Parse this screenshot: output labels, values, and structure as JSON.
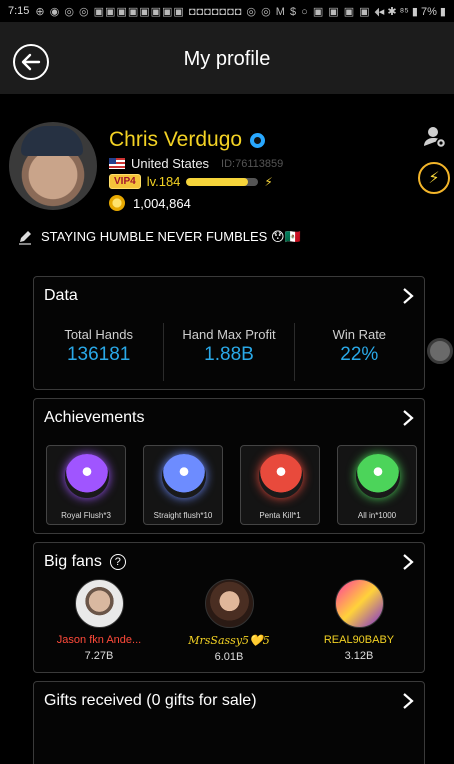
{
  "status_bar": {
    "time": "7:15",
    "notifications": "⊕ ◉ ◎ ◎ ▣▣▣▣▣▣▣▣ ◘◘◘◘◘◘◘ ◎ ◎ M $ ○ ▣ ▣ ▣ ▣ ◆",
    "right": "◂ ✱ ⁸⁵ ▮ 7% ▮"
  },
  "header": {
    "title": "My profile"
  },
  "profile": {
    "name": "Chris Verdugo",
    "country": "United States",
    "id": "ID:76113859",
    "vip": "VIP4",
    "level": "lv.184",
    "level_progress": 0.86,
    "coins": "1,004,864",
    "bio": "STAYING HUMBLE NEVER FUMBLES 😯🇲🇽"
  },
  "data_card": {
    "title": "Data",
    "stats": [
      {
        "label": "Total Hands",
        "value": "136181"
      },
      {
        "label": "Hand Max Profit",
        "value": "1.88B"
      },
      {
        "label": "Win Rate",
        "value": "22%"
      }
    ]
  },
  "achievements_card": {
    "title": "Achievements",
    "items": [
      {
        "label": "Royal Flush*3",
        "color": "#a055ff"
      },
      {
        "label": "Straight flush*10",
        "color": "#6d8cff"
      },
      {
        "label": "Penta Kill*1",
        "color": "#e84a3c"
      },
      {
        "label": "All in*1000",
        "color": "#4cd45a"
      }
    ]
  },
  "fans_card": {
    "title": "Big fans",
    "fans": [
      {
        "name": "Jason fkn Ande...",
        "score": "7.27B",
        "name_color": "#ff4a3a"
      },
      {
        "name": "MrsSassy5💛5",
        "score": "6.01B",
        "name_color": "#f3d224"
      },
      {
        "name": "REAL90BABY",
        "score": "3.12B",
        "name_color": "#f3d224"
      }
    ]
  },
  "gifts_card": {
    "title": "Gifts received (0 gifts for sale)"
  }
}
